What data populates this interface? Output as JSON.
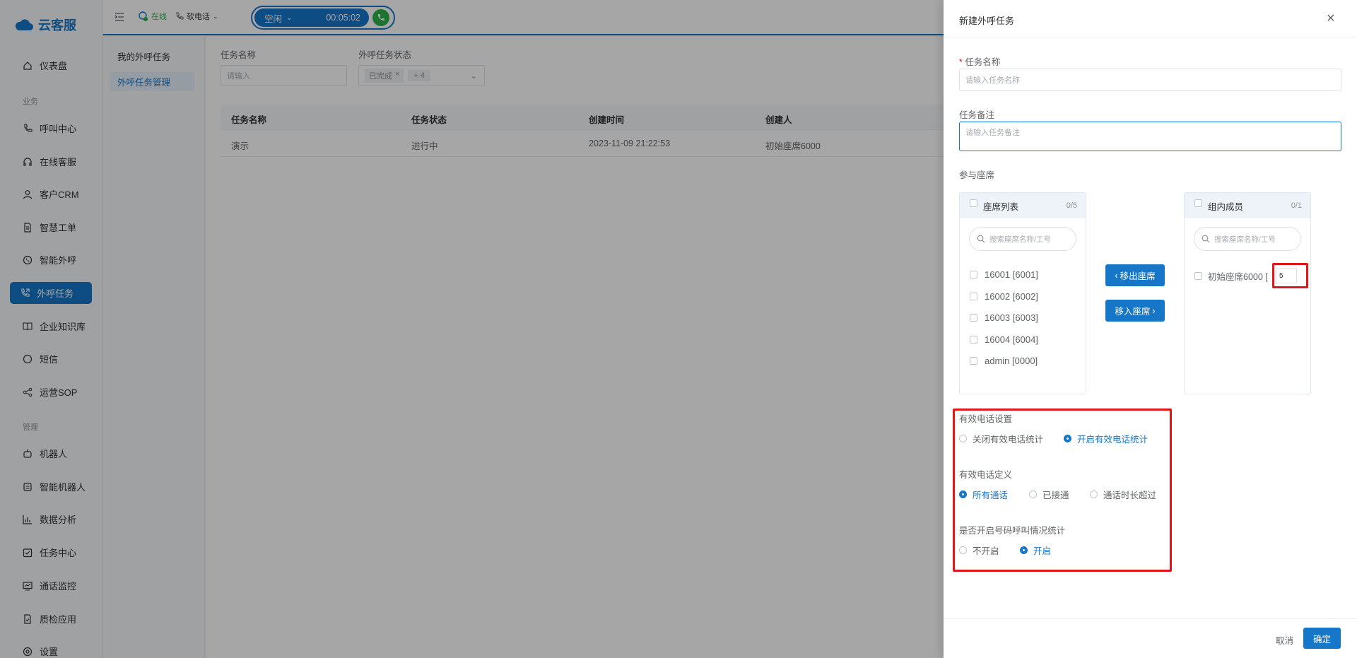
{
  "app": {
    "logo_text": "云客服"
  },
  "sidebar": {
    "items": [
      {
        "label": "仪表盘",
        "icon": "home-icon"
      },
      {
        "group": "业务"
      },
      {
        "label": "呼叫中心",
        "icon": "phone-icon"
      },
      {
        "label": "在线客服",
        "icon": "headset-icon"
      },
      {
        "label": "客户CRM",
        "icon": "user-icon"
      },
      {
        "label": "智慧工单",
        "icon": "document-icon"
      },
      {
        "label": "智能外呼",
        "icon": "chat-phone-icon"
      },
      {
        "label": "外呼任务",
        "icon": "outbound-icon",
        "active": true
      },
      {
        "label": "企业知识库",
        "icon": "book-icon"
      },
      {
        "label": "短信",
        "icon": "message-icon"
      },
      {
        "label": "运营SOP",
        "icon": "share-icon"
      },
      {
        "group": "管理"
      },
      {
        "label": "机器人",
        "icon": "robot-icon"
      },
      {
        "label": "智能机器人",
        "icon": "smart-robot-icon"
      },
      {
        "label": "数据分析",
        "icon": "chart-icon"
      },
      {
        "label": "任务中心",
        "icon": "task-icon"
      },
      {
        "label": "通话监控",
        "icon": "monitor-icon"
      },
      {
        "label": "质检应用",
        "icon": "quality-icon"
      },
      {
        "label": "设置",
        "icon": "settings-icon"
      }
    ]
  },
  "topbar": {
    "online_label": "在线",
    "softphone_label": "软电话",
    "status_label": "空闲",
    "timer": "00:05:02"
  },
  "subnav": {
    "items": [
      {
        "label": "我的外呼任务"
      },
      {
        "label": "外呼任务管理",
        "active": true
      }
    ]
  },
  "filters": {
    "task_name_label": "任务名称",
    "task_name_placeholder": "请输入",
    "status_label": "外呼任务状态",
    "status_tag": "已完成",
    "status_more": "+ 4"
  },
  "table": {
    "headers": [
      "任务名称",
      "任务状态",
      "创建时间",
      "创建人"
    ],
    "rows": [
      [
        "演示",
        "进行中",
        "2023-11-09 21:22:53",
        "初始座席6000"
      ]
    ]
  },
  "drawer": {
    "title": "新建外呼任务",
    "required_mark": "*",
    "name_label": "任务名称",
    "name_placeholder": "请输入任务名称",
    "remark_label": "任务备注",
    "remark_placeholder": "请输入任务备注",
    "agents_label": "参与座席",
    "left_panel": {
      "title": "座席列表",
      "count": "0/5",
      "search_placeholder": "搜索座席名称/工号",
      "items": [
        "16001 [6001]",
        "16002 [6002]",
        "16003 [6003]",
        "16004 [6004]",
        "admin [0000]"
      ]
    },
    "move_out_label": "移出座席",
    "move_in_label": "移入座席",
    "right_panel": {
      "title": "组内成员",
      "count": "0/1",
      "search_placeholder": "搜索座席名称/工号",
      "item_label": "初始座席6000 [",
      "item_value": "5"
    },
    "valid_call_setting": {
      "label": "有效电话设置",
      "options": [
        "关闭有效电话统计",
        "开启有效电话统计"
      ],
      "selected": 1
    },
    "valid_call_definition": {
      "label": "有效电话定义",
      "options": [
        "所有通话",
        "已接通",
        "通话时长超过"
      ],
      "selected": 0
    },
    "number_call_stats": {
      "label": "是否开启号码呼叫情况统计",
      "options": [
        "不开启",
        "开启"
      ],
      "selected": 1
    },
    "cancel_label": "取消",
    "confirm_label": "确定"
  },
  "colors": {
    "accent": "#1677c9",
    "highlight": "#e0161b",
    "call_green": "#2bb34a"
  }
}
